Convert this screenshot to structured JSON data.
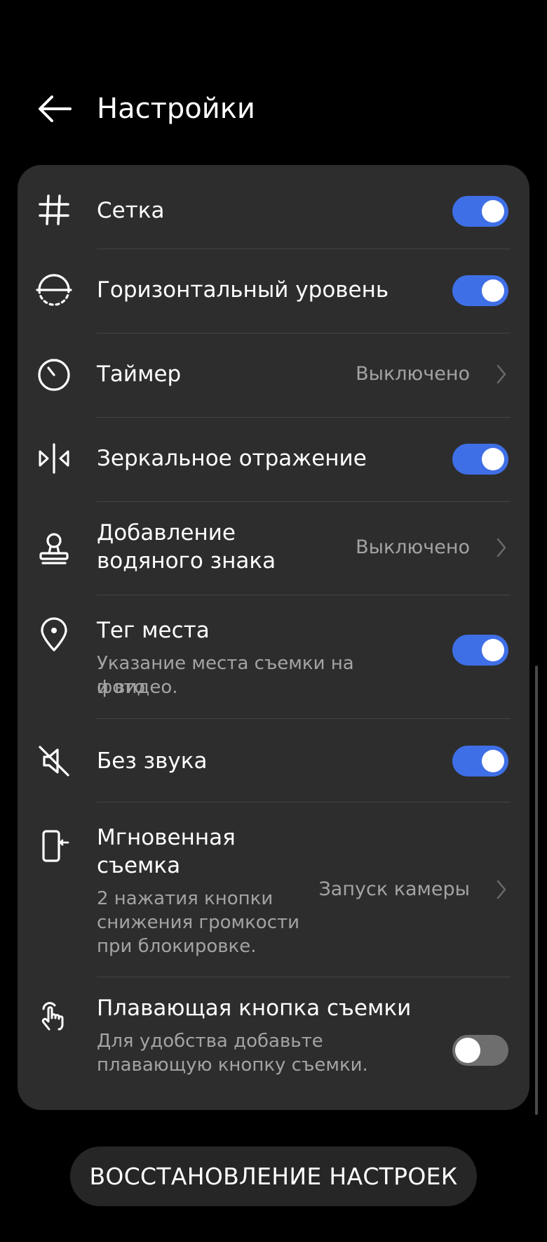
{
  "header": {
    "title": "Настройки",
    "back_icon": "arrow-left-icon"
  },
  "settings": {
    "grid": {
      "title": "Сетка",
      "icon": "grid-icon",
      "toggle": "on"
    },
    "level": {
      "title": "Горизонтальный уровень",
      "icon": "horizon-level-icon",
      "toggle": "on"
    },
    "timer": {
      "title": "Таймер",
      "icon": "timer-icon",
      "value": "Выключено"
    },
    "mirror": {
      "title": "Зеркальное отражение",
      "icon": "mirror-icon",
      "toggle": "on"
    },
    "watermark": {
      "title_line1": "Добавление",
      "title_line2": "водяного знака",
      "icon": "stamp-icon",
      "value": "Выключено"
    },
    "location": {
      "title": "Тег места",
      "subtitle_line1": "Указание места съемки на фото",
      "subtitle_line2": "и видео.",
      "icon": "location-pin-icon",
      "toggle": "on"
    },
    "mute": {
      "title": "Без звука",
      "icon": "mute-icon",
      "toggle": "on"
    },
    "snapshot": {
      "title_line1": "Мгновенная",
      "title_line2": "съемка",
      "subtitle_line1": "2 нажатия кнопки",
      "subtitle_line2": "снижения громкости",
      "subtitle_line3": "при блокировке.",
      "icon": "phone-side-button-icon",
      "value": "Запуск камеры"
    },
    "floating": {
      "title": "Плавающая кнопка съемки",
      "subtitle_line1": "Для удобства добавьте",
      "subtitle_line2": "плавающую кнопку съемки.",
      "icon": "touch-hand-icon",
      "toggle": "off"
    }
  },
  "restore_button": "ВОССТАНОВЛЕНИЕ НАСТРОЕК",
  "colors": {
    "accent": "#3f6fe6",
    "card": "#2d2d2d",
    "background": "#000000",
    "secondary_text": "#a3a3a3"
  }
}
